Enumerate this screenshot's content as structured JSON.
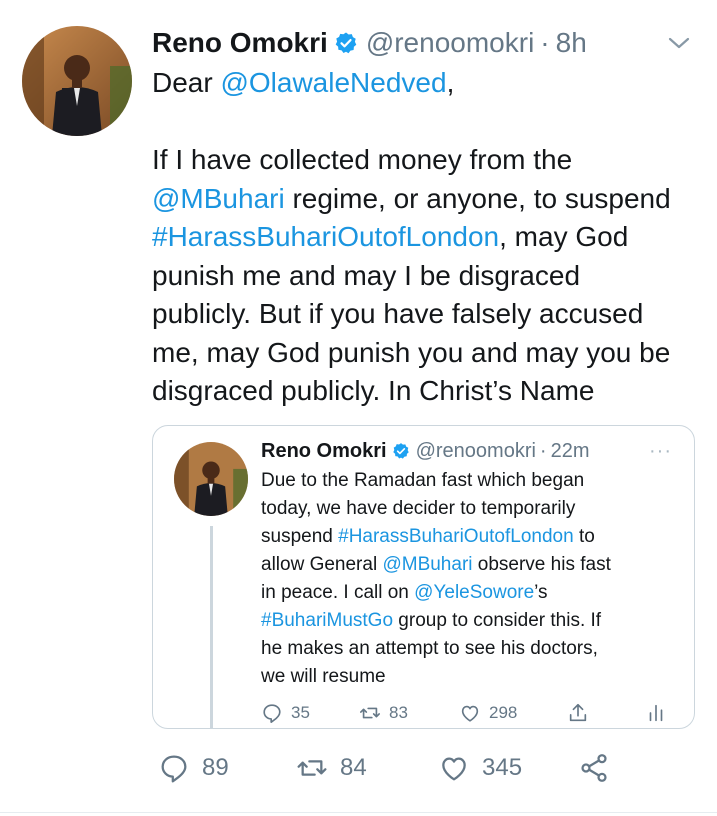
{
  "tweet": {
    "author_name": "Reno Omokri",
    "handle": "@renoomokri",
    "separator": "·",
    "time": "8h",
    "greeting_prefix": "Dear ",
    "greeting_mention": "@OlawaleNedved",
    "greeting_suffix": ",",
    "para_1": "If I have collected money from the",
    "para_mention": "@MBuhari",
    "para_2": " regime, or anyone, to suspend",
    "para_hashtag": "#HarassBuhariOutofLondon",
    "para_3": ", may God",
    "para_4": "punish me and may I be disgraced",
    "para_5": "publicly. But if you have falsely accused",
    "para_6": "me, may God punish you and may you be",
    "para_7": "disgraced publicly. In Christ’s Name",
    "reply_count": "89",
    "retweet_count": "84",
    "like_count": "345"
  },
  "quoted": {
    "author_name": "Reno Omokri",
    "handle": "@renoomokri",
    "separator": "·",
    "time": "22m",
    "more": "···",
    "l1": "Due to the Ramadan fast which began",
    "l2": "today, we have decider to temporarily",
    "l3a": "suspend ",
    "l3_hashtag": "#HarassBuhariOutofLondon",
    "l3b": " to",
    "l4a": "allow General ",
    "l4_mention": "@MBuhari",
    "l4b": " observe his fast",
    "l5a": "in peace. I call on ",
    "l5_mention": "@YeleSowore",
    "l5b": "’s",
    "l6_hashtag": "#BuhariMustGo",
    "l6b": " group to consider this. If",
    "l7": "he makes an attempt to see his doctors,",
    "l8": "we will resume",
    "reply_count": "35",
    "retweet_count": "83",
    "like_count": "298"
  },
  "icons": {
    "verified": "verified-badge-icon",
    "caret": "chevron-down-icon",
    "reply": "reply-icon",
    "retweet": "retweet-icon",
    "like": "heart-icon",
    "share": "share-icon",
    "analytics": "analytics-icon"
  },
  "colors": {
    "link": "#1b95e0",
    "muted": "#657786",
    "border": "#ccd6dd",
    "verified": "#1da1f2"
  }
}
